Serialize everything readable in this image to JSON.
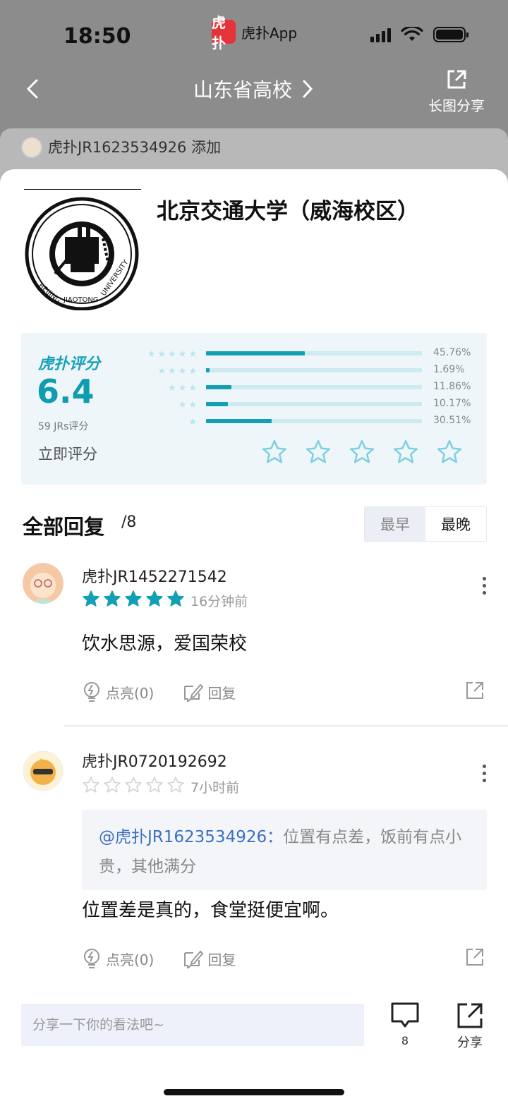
{
  "status_bar": {
    "time": "18:50",
    "app_label": "虎扑App",
    "app_logo_text": "虎扑"
  },
  "nav": {
    "title": "山东省高校",
    "share_label": "长图分享"
  },
  "adder": {
    "text": "虎扑JR1623534926 添加"
  },
  "school": {
    "name": "北京交通大学（威海校区）",
    "logo_text": "BEIJING JIAOTONG UNIVERSITY"
  },
  "rating": {
    "brand": "虎扑评分",
    "score": "6.4",
    "count": "59 JRs评分",
    "rate_now": "立即评分",
    "distribution": [
      {
        "stars": "★★★★★",
        "pct_label": "45.76%",
        "pct": 45.76
      },
      {
        "stars": "★★★★",
        "pct_label": "1.69%",
        "pct": 1.69
      },
      {
        "stars": "★★★",
        "pct_label": "11.86%",
        "pct": 11.86
      },
      {
        "stars": "★★",
        "pct_label": "10.17%",
        "pct": 10.17
      },
      {
        "stars": "★",
        "pct_label": "30.51%",
        "pct": 30.51
      }
    ]
  },
  "replies": {
    "title": "全部回复",
    "count": "/8",
    "sort_early": "最早",
    "sort_late": "最晚"
  },
  "comments": [
    {
      "user": "虎扑JR1452271542",
      "rating": 5,
      "time": "16分钟前",
      "body": "饮水思源，爱国荣校",
      "like_label": "点亮(0)",
      "reply_label": "回复"
    },
    {
      "user": "虎扑JR0720192692",
      "rating": 0,
      "time": "7小时前",
      "quote_user": "@虎扑JR1623534926：",
      "quote_text": "位置有点差，饭前有点小贵，其他满分",
      "body": "位置差是真的，食堂挺便宜啊。",
      "like_label": "点亮(0)",
      "reply_label": "回复"
    }
  ],
  "bottom": {
    "input_placeholder": "分享一下你的看法吧~",
    "comment_count": "8",
    "share_label": "分享"
  },
  "colors": {
    "accent": "#139fb4",
    "star_active": "#139fb4",
    "star_inactive": "#d5d5d5",
    "link": "#3b6fc4"
  }
}
